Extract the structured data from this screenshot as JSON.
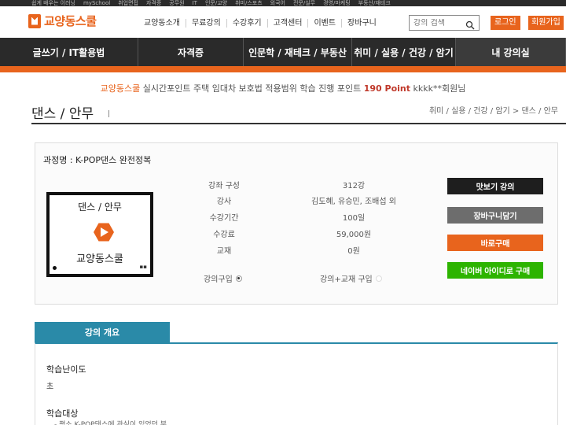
{
  "top_strip": [
    "쉽게 배우는 이러닝",
    "mySchool",
    "취업면접",
    "자격증",
    "공무원",
    "IT",
    "인문/교양",
    "취미/스포츠",
    "외국어",
    "전문/실무",
    "경영/마케팅",
    "부동산/재테크"
  ],
  "logo_text": "교양동스쿨",
  "top_nav": [
    "교양동소개",
    "무료강의",
    "수강후기",
    "고객센터",
    "이벤트",
    "장바구니"
  ],
  "search": {
    "placeholder": "강의 검색"
  },
  "header_buttons": {
    "login": "로그인",
    "join": "회원가입"
  },
  "main_nav": [
    "글쓰기 / IT활용법",
    "자격증",
    "인문학 / 재테크 / 부동산",
    "취미 / 실용 / 건강 / 암기",
    "내 강의실"
  ],
  "point_line": {
    "brand": "교양동스쿨",
    "text": "실시간포인트 주택 임대차 보호법 적용범위 학습 진행 포인트",
    "points": "190 Point",
    "user": "kkkk**회원님"
  },
  "page": {
    "title": "댄스 / 안무",
    "title_mark": "|",
    "breadcrumb": "취미 / 실용 / 건강 / 암기 > 댄스 / 안무"
  },
  "course": {
    "name": "과정명 : K-POP댄스 완전정복",
    "thumbnail": {
      "category": "댄스 / 안무",
      "brand": "교양동스쿨"
    },
    "info": [
      {
        "label": "강좌 구성",
        "value": "312강"
      },
      {
        "label": "강사",
        "value": "김도혜, 유승민, 조배섭 외"
      },
      {
        "label": "수강기간",
        "value": "100일"
      },
      {
        "label": "수강료",
        "value": "59,000원"
      },
      {
        "label": "교재",
        "value": "0원"
      }
    ],
    "options": [
      {
        "label": "강의구입",
        "checked": true
      },
      {
        "label": "강의+교재 구입",
        "checked": false
      }
    ],
    "actions": {
      "preview": "맛보기 강의",
      "cart": "장바구니담기",
      "buy": "바로구매",
      "naver": "네이버 아이디로 구매"
    }
  },
  "overview": {
    "tab": "강의 개요",
    "difficulty_label": "학습난이도",
    "difficulty_value": "초",
    "target_label": "학습대상",
    "target_value": "- 평소 K-POP댄스에 관심이 있었던 분"
  },
  "colors": {
    "accent": "#e8641d",
    "nav_bg": "#2a2a2a",
    "teal": "#2a8aa8",
    "naver": "#2db400"
  }
}
